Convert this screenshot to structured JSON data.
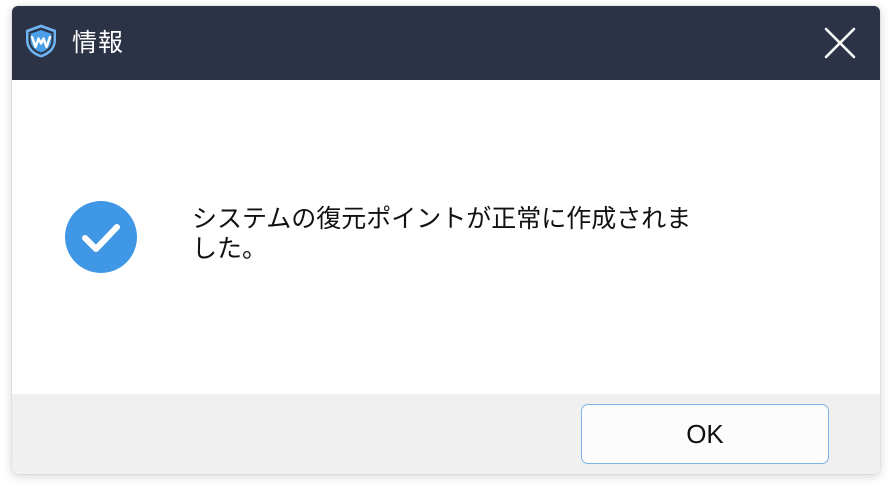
{
  "window": {
    "title": "情報",
    "app_icon": "wise-shield-logo-icon",
    "close_icon": "close-icon"
  },
  "content": {
    "status_icon": "checkmark-circle-icon",
    "message": "システムの復元ポイントが正常に作成されました。"
  },
  "footer": {
    "ok_label": "OK"
  },
  "colors": {
    "titlebar": "#2d3347",
    "success": "#3f97e5",
    "button_border": "#7fb2e6",
    "footer_bg": "#f0f0f0"
  }
}
